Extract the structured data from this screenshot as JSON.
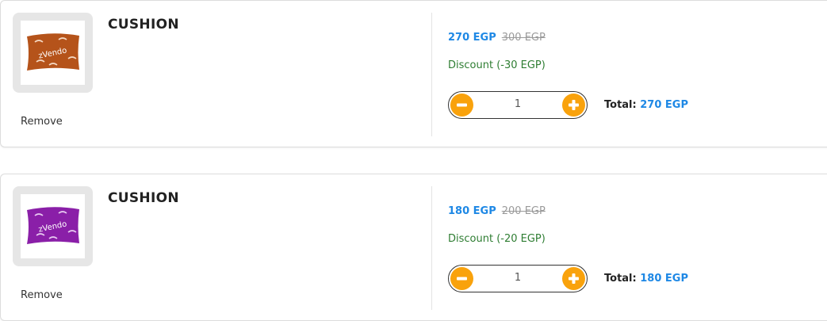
{
  "cart": {
    "items": [
      {
        "name": "CUSHION",
        "image_brand_text": "zVendo",
        "image_color": "#b5531a",
        "price": "270 EGP",
        "old_price": "300 EGP",
        "discount": "Discount (-30 EGP)",
        "quantity": "1",
        "total_label": "Total:",
        "total_value": "270 EGP",
        "remove_label": "Remove"
      },
      {
        "name": "CUSHION",
        "image_brand_text": "zVendo",
        "image_color": "#8a1fa8",
        "price": "180 EGP",
        "old_price": "200 EGP",
        "discount": "Discount (-20 EGP)",
        "quantity": "1",
        "total_label": "Total:",
        "total_value": "180 EGP",
        "remove_label": "Remove"
      }
    ]
  },
  "icons": {
    "decrease": "minus-icon",
    "increase": "plus-icon"
  },
  "colors": {
    "accent_price": "#1e88e5",
    "discount": "#2e7d32",
    "stepper_button": "#f9a20c"
  }
}
